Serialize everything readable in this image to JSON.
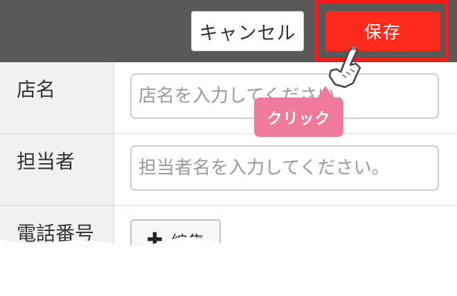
{
  "header": {
    "cancel_label": "キャンセル",
    "save_label": "保存"
  },
  "form": {
    "rows": [
      {
        "label": "店名",
        "placeholder": "店名を入力してください。"
      },
      {
        "label": "担当者",
        "placeholder": "担当者名を入力してください。"
      },
      {
        "label": "電話番号",
        "edit_label": "編集",
        "edit_icon": "plus-icon"
      }
    ]
  },
  "annotation": {
    "tooltip_text": "クリック",
    "cursor_icon": "hand-pointer-icon"
  },
  "colors": {
    "header_bg": "#595959",
    "save_button": "#ff2a1c",
    "highlight_outline": "#ff1a1a",
    "tooltip_bg": "#f07a9c"
  }
}
